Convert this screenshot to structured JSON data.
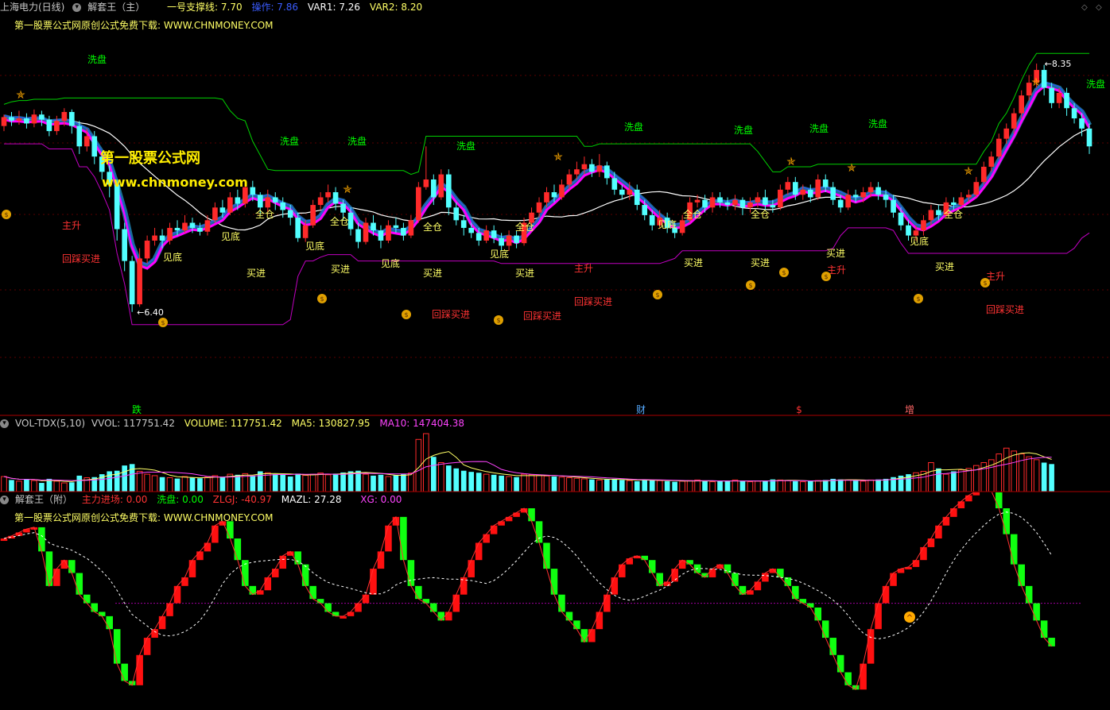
{
  "main_header": {
    "stock": "上海电力(日线)",
    "indicator": "解套王（主）",
    "support_label": "一号支撑线: 7.70",
    "op_label": "操作: 7.86",
    "var1_label": "VAR1: 7.26",
    "var2_label": "VAR2: 8.20"
  },
  "watermark_top": "第一股票公式网原创公式免费下载: WWW.CHNMONEY.COM",
  "logo_cn": "第一股票公式网",
  "logo_url": "www.chnmoney.com",
  "vol_header": {
    "name": "VOL-TDX(5,10)",
    "vvol": "VVOL: 117751.42",
    "volume": "VOLUME: 117751.42",
    "ma5": "MA5: 130827.95",
    "ma10": "MA10: 147404.38"
  },
  "sub_header": {
    "name": "解套王（附）",
    "zhuli": "主力进场: 0.00",
    "xipan": "洗盘: 0.00",
    "zlgj": "ZLGJ: -40.97",
    "mazl": "MAZL: 27.28",
    "xg": "XG: 0.00"
  },
  "watermark_sub": "第一股票公式网原创公式免费下载: WWW.CHNMONEY.COM",
  "colors": {
    "up": "#ff2a2a",
    "down": "#52ffff",
    "magenta": "#ff00ff",
    "green": "#00ff00",
    "yellow": "#ffff66",
    "red_text": "#ff3333",
    "steel": "#1e7fb0"
  },
  "chart_data": {
    "type": "candlestick",
    "price_high_label": "8.35",
    "price_low_label": "6.40",
    "ylim": [
      5.7,
      8.6
    ],
    "candles": [
      [
        7.86,
        7.93,
        7.95,
        7.82
      ],
      [
        7.93,
        7.9,
        7.97,
        7.86
      ],
      [
        7.9,
        7.92,
        7.98,
        7.87
      ],
      [
        7.92,
        7.88,
        7.96,
        7.84
      ],
      [
        7.88,
        7.95,
        7.99,
        7.85
      ],
      [
        7.95,
        7.91,
        7.98,
        7.86
      ],
      [
        7.91,
        7.82,
        7.94,
        7.78
      ],
      [
        7.82,
        7.9,
        7.94,
        7.79
      ],
      [
        7.9,
        7.97,
        8.0,
        7.86
      ],
      [
        7.97,
        7.86,
        7.99,
        7.8
      ],
      [
        7.86,
        7.7,
        7.9,
        7.64
      ],
      [
        7.7,
        7.78,
        7.84,
        7.66
      ],
      [
        7.78,
        7.62,
        7.82,
        7.56
      ],
      [
        7.62,
        7.5,
        7.66,
        7.44
      ],
      [
        7.5,
        7.4,
        7.55,
        7.3
      ],
      [
        7.4,
        7.05,
        7.44,
        6.96
      ],
      [
        7.05,
        6.8,
        7.1,
        6.72
      ],
      [
        6.8,
        6.46,
        6.84,
        6.4
      ],
      [
        6.46,
        6.82,
        6.9,
        6.44
      ],
      [
        6.82,
        6.96,
        7.0,
        6.78
      ],
      [
        6.96,
        7.0,
        7.06,
        6.92
      ],
      [
        7.0,
        6.96,
        7.05,
        6.9
      ],
      [
        6.96,
        7.06,
        7.1,
        6.93
      ],
      [
        7.06,
        7.04,
        7.12,
        7.0
      ],
      [
        7.04,
        7.1,
        7.16,
        7.02
      ],
      [
        7.1,
        7.06,
        7.14,
        7.02
      ],
      [
        7.06,
        7.03,
        7.1,
        7.0
      ],
      [
        7.03,
        7.12,
        7.16,
        7.0
      ],
      [
        7.12,
        7.22,
        7.26,
        7.1
      ],
      [
        7.22,
        7.18,
        7.28,
        7.14
      ],
      [
        7.18,
        7.3,
        7.34,
        7.16
      ],
      [
        7.3,
        7.25,
        7.36,
        7.2
      ],
      [
        7.25,
        7.38,
        7.42,
        7.22
      ],
      [
        7.38,
        7.32,
        7.43,
        7.27
      ],
      [
        7.32,
        7.22,
        7.34,
        7.16
      ],
      [
        7.22,
        7.3,
        7.36,
        7.18
      ],
      [
        7.3,
        7.26,
        7.34,
        7.2
      ],
      [
        7.26,
        7.2,
        7.3,
        7.14
      ],
      [
        7.2,
        7.14,
        7.24,
        7.08
      ],
      [
        7.14,
        6.98,
        7.18,
        6.95
      ],
      [
        6.98,
        7.08,
        7.12,
        6.95
      ],
      [
        7.08,
        7.24,
        7.28,
        7.06
      ],
      [
        7.24,
        7.3,
        7.34,
        7.2
      ],
      [
        7.3,
        7.34,
        7.4,
        7.26
      ],
      [
        7.34,
        7.25,
        7.38,
        7.2
      ],
      [
        7.25,
        7.18,
        7.28,
        7.12
      ],
      [
        7.18,
        7.05,
        7.22,
        7.0
      ],
      [
        7.05,
        6.95,
        7.1,
        6.9
      ],
      [
        6.95,
        7.1,
        7.14,
        6.93
      ],
      [
        7.1,
        7.04,
        7.16,
        7.0
      ],
      [
        7.04,
        6.96,
        7.08,
        6.9
      ],
      [
        6.96,
        7.08,
        7.12,
        6.94
      ],
      [
        7.08,
        7.06,
        7.14,
        7.02
      ],
      [
        7.06,
        7.0,
        7.1,
        6.96
      ],
      [
        7.0,
        7.12,
        7.16,
        6.98
      ],
      [
        7.12,
        7.38,
        7.42,
        7.1
      ],
      [
        7.38,
        7.44,
        7.7,
        7.36
      ],
      [
        7.44,
        7.3,
        7.48,
        7.24
      ],
      [
        7.3,
        7.48,
        7.52,
        7.28
      ],
      [
        7.48,
        7.22,
        7.52,
        7.16
      ],
      [
        7.22,
        7.12,
        7.26,
        7.08
      ],
      [
        7.12,
        7.06,
        7.16,
        7.0
      ],
      [
        7.06,
        7.02,
        7.1,
        6.98
      ],
      [
        7.02,
        6.96,
        7.06,
        6.92
      ],
      [
        6.96,
        7.04,
        7.08,
        6.94
      ],
      [
        7.04,
        6.98,
        7.08,
        6.94
      ],
      [
        6.98,
        6.92,
        7.02,
        6.88
      ],
      [
        6.92,
        7.0,
        7.04,
        6.88
      ],
      [
        7.0,
        6.94,
        7.04,
        6.9
      ],
      [
        6.94,
        7.1,
        7.14,
        6.92
      ],
      [
        7.1,
        7.18,
        7.22,
        7.06
      ],
      [
        7.18,
        7.26,
        7.3,
        7.14
      ],
      [
        7.26,
        7.34,
        7.38,
        7.22
      ],
      [
        7.34,
        7.3,
        7.4,
        7.26
      ],
      [
        7.3,
        7.4,
        7.44,
        7.28
      ],
      [
        7.4,
        7.48,
        7.52,
        7.36
      ],
      [
        7.48,
        7.52,
        7.58,
        7.44
      ],
      [
        7.52,
        7.56,
        7.62,
        7.48
      ],
      [
        7.56,
        7.5,
        7.6,
        7.46
      ],
      [
        7.5,
        7.55,
        7.64,
        7.46
      ],
      [
        7.55,
        7.45,
        7.58,
        7.4
      ],
      [
        7.45,
        7.36,
        7.5,
        7.32
      ],
      [
        7.36,
        7.32,
        7.4,
        7.28
      ],
      [
        7.32,
        7.36,
        7.42,
        7.28
      ],
      [
        7.36,
        7.24,
        7.4,
        7.2
      ],
      [
        7.24,
        7.16,
        7.28,
        7.12
      ],
      [
        7.16,
        7.08,
        7.2,
        7.04
      ],
      [
        7.08,
        7.14,
        7.2,
        7.06
      ],
      [
        7.14,
        7.06,
        7.18,
        7.02
      ],
      [
        7.06,
        7.02,
        7.1,
        6.98
      ],
      [
        7.02,
        7.12,
        7.16,
        7.0
      ],
      [
        7.12,
        7.26,
        7.3,
        7.1
      ],
      [
        7.26,
        7.28,
        7.32,
        7.22
      ],
      [
        7.28,
        7.22,
        7.32,
        7.18
      ],
      [
        7.22,
        7.3,
        7.34,
        7.18
      ],
      [
        7.3,
        7.26,
        7.34,
        7.22
      ],
      [
        7.26,
        7.24,
        7.3,
        7.2
      ],
      [
        7.24,
        7.28,
        7.32,
        7.2
      ],
      [
        7.28,
        7.22,
        7.3,
        7.16
      ],
      [
        7.22,
        7.26,
        7.3,
        7.18
      ],
      [
        7.26,
        7.3,
        7.34,
        7.22
      ],
      [
        7.3,
        7.24,
        7.36,
        7.2
      ],
      [
        7.24,
        7.22,
        7.28,
        7.18
      ],
      [
        7.22,
        7.36,
        7.4,
        7.2
      ],
      [
        7.36,
        7.42,
        7.46,
        7.32
      ],
      [
        7.42,
        7.32,
        7.46,
        7.28
      ],
      [
        7.32,
        7.36,
        7.4,
        7.28
      ],
      [
        7.36,
        7.3,
        7.4,
        7.26
      ],
      [
        7.3,
        7.44,
        7.48,
        7.28
      ],
      [
        7.44,
        7.38,
        7.48,
        7.34
      ],
      [
        7.38,
        7.28,
        7.42,
        7.24
      ],
      [
        7.28,
        7.22,
        7.32,
        7.18
      ],
      [
        7.22,
        7.32,
        7.36,
        7.2
      ],
      [
        7.32,
        7.3,
        7.36,
        7.26
      ],
      [
        7.3,
        7.34,
        7.38,
        7.26
      ],
      [
        7.34,
        7.38,
        7.42,
        7.3
      ],
      [
        7.38,
        7.32,
        7.42,
        7.28
      ],
      [
        7.32,
        7.28,
        7.36,
        7.22
      ],
      [
        7.28,
        7.18,
        7.32,
        7.14
      ],
      [
        7.18,
        7.08,
        7.22,
        7.04
      ],
      [
        7.08,
        7.0,
        7.12,
        6.96
      ],
      [
        7.0,
        7.04,
        7.08,
        6.96
      ],
      [
        7.04,
        7.12,
        7.16,
        7.0
      ],
      [
        7.12,
        7.2,
        7.24,
        7.08
      ],
      [
        7.2,
        7.16,
        7.24,
        7.12
      ],
      [
        7.16,
        7.26,
        7.3,
        7.14
      ],
      [
        7.26,
        7.24,
        7.3,
        7.2
      ],
      [
        7.24,
        7.3,
        7.34,
        7.22
      ],
      [
        7.3,
        7.32,
        7.36,
        7.26
      ],
      [
        7.32,
        7.42,
        7.46,
        7.3
      ],
      [
        7.42,
        7.54,
        7.58,
        7.4
      ],
      [
        7.54,
        7.62,
        7.66,
        7.5
      ],
      [
        7.62,
        7.76,
        7.8,
        7.6
      ],
      [
        7.76,
        7.84,
        7.88,
        7.72
      ],
      [
        7.84,
        7.96,
        8.0,
        7.8
      ],
      [
        7.96,
        8.1,
        8.14,
        7.92
      ],
      [
        8.1,
        8.2,
        8.26,
        8.06
      ],
      [
        8.2,
        8.3,
        8.35,
        8.16
      ],
      [
        8.3,
        8.16,
        8.34,
        8.1
      ],
      [
        8.16,
        8.04,
        8.2,
        8.0
      ],
      [
        8.04,
        8.12,
        8.16,
        8.0
      ],
      [
        8.12,
        8.0,
        8.16,
        7.94
      ],
      [
        8.0,
        7.92,
        8.04,
        7.88
      ],
      [
        7.92,
        7.84,
        7.96,
        7.78
      ],
      [
        7.84,
        7.7,
        7.88,
        7.64
      ]
    ],
    "volume": [
      52,
      40,
      36,
      42,
      38,
      30,
      44,
      36,
      30,
      32,
      55,
      48,
      50,
      60,
      70,
      72,
      90,
      95,
      70,
      60,
      55,
      50,
      48,
      45,
      52,
      48,
      46,
      50,
      55,
      50,
      60,
      58,
      62,
      55,
      70,
      65,
      60,
      58,
      52,
      62,
      56,
      60,
      64,
      58,
      62,
      66,
      70,
      72,
      60,
      55,
      58,
      52,
      56,
      60,
      64,
      180,
      200,
      120,
      100,
      90,
      80,
      72,
      68,
      65,
      60,
      58,
      55,
      52,
      50,
      60,
      58,
      56,
      54,
      52,
      50,
      48,
      46,
      44,
      42,
      40,
      42,
      44,
      40,
      38,
      36,
      42,
      40,
      38,
      36,
      34,
      36,
      38,
      40,
      36,
      34,
      36,
      38,
      40,
      36,
      34,
      36,
      38,
      42,
      40,
      38,
      36,
      34,
      36,
      38,
      40,
      44,
      42,
      40,
      38,
      36,
      40,
      42,
      44,
      50,
      55,
      60,
      65,
      70,
      100,
      80,
      60,
      70,
      75,
      80,
      90,
      100,
      110,
      130,
      150,
      140,
      130,
      120,
      110,
      100,
      95
    ],
    "sub_values": [
      -5,
      -2,
      2,
      6,
      8,
      -20,
      -60,
      -40,
      -30,
      -45,
      -70,
      -80,
      -90,
      -95,
      -110,
      -150,
      -170,
      -175,
      -140,
      -120,
      -110,
      -95,
      -80,
      -60,
      -50,
      -30,
      -20,
      -10,
      10,
      15,
      -5,
      -30,
      -60,
      -70,
      -65,
      -50,
      -40,
      -25,
      -20,
      -35,
      -60,
      -75,
      -80,
      -90,
      -95,
      -95,
      -90,
      -80,
      -70,
      -40,
      -20,
      10,
      20,
      -30,
      -60,
      -75,
      -80,
      -90,
      -100,
      -90,
      -70,
      -50,
      -30,
      -10,
      0,
      10,
      15,
      20,
      25,
      30,
      15,
      -10,
      -40,
      -70,
      -90,
      -100,
      -110,
      -125,
      -110,
      -90,
      -70,
      -50,
      -35,
      -28,
      -25,
      -30,
      -45,
      -60,
      -55,
      -40,
      -30,
      -35,
      -45,
      -50,
      -40,
      -35,
      -45,
      -60,
      -70,
      -65,
      -55,
      -45,
      -40,
      -50,
      -60,
      -75,
      -80,
      -85,
      -100,
      -120,
      -140,
      -160,
      -175,
      -180,
      -150,
      -110,
      -80,
      -60,
      -45,
      -40,
      -38,
      -30,
      -15,
      -5,
      10,
      20,
      30,
      38,
      45,
      50,
      55,
      50,
      30,
      0,
      -35,
      -60,
      -80,
      -100,
      -120,
      -130
    ],
    "labels": {
      "xipan": "洗盘",
      "zhusheng": "主升",
      "huicai": "回踩买进",
      "jiandi": "见底",
      "maijin": "买进",
      "quancang": "全仓"
    },
    "bottom_marks": {
      "die": "跌",
      "cai": "财",
      "dollar": "$",
      "zeng": "增"
    }
  }
}
